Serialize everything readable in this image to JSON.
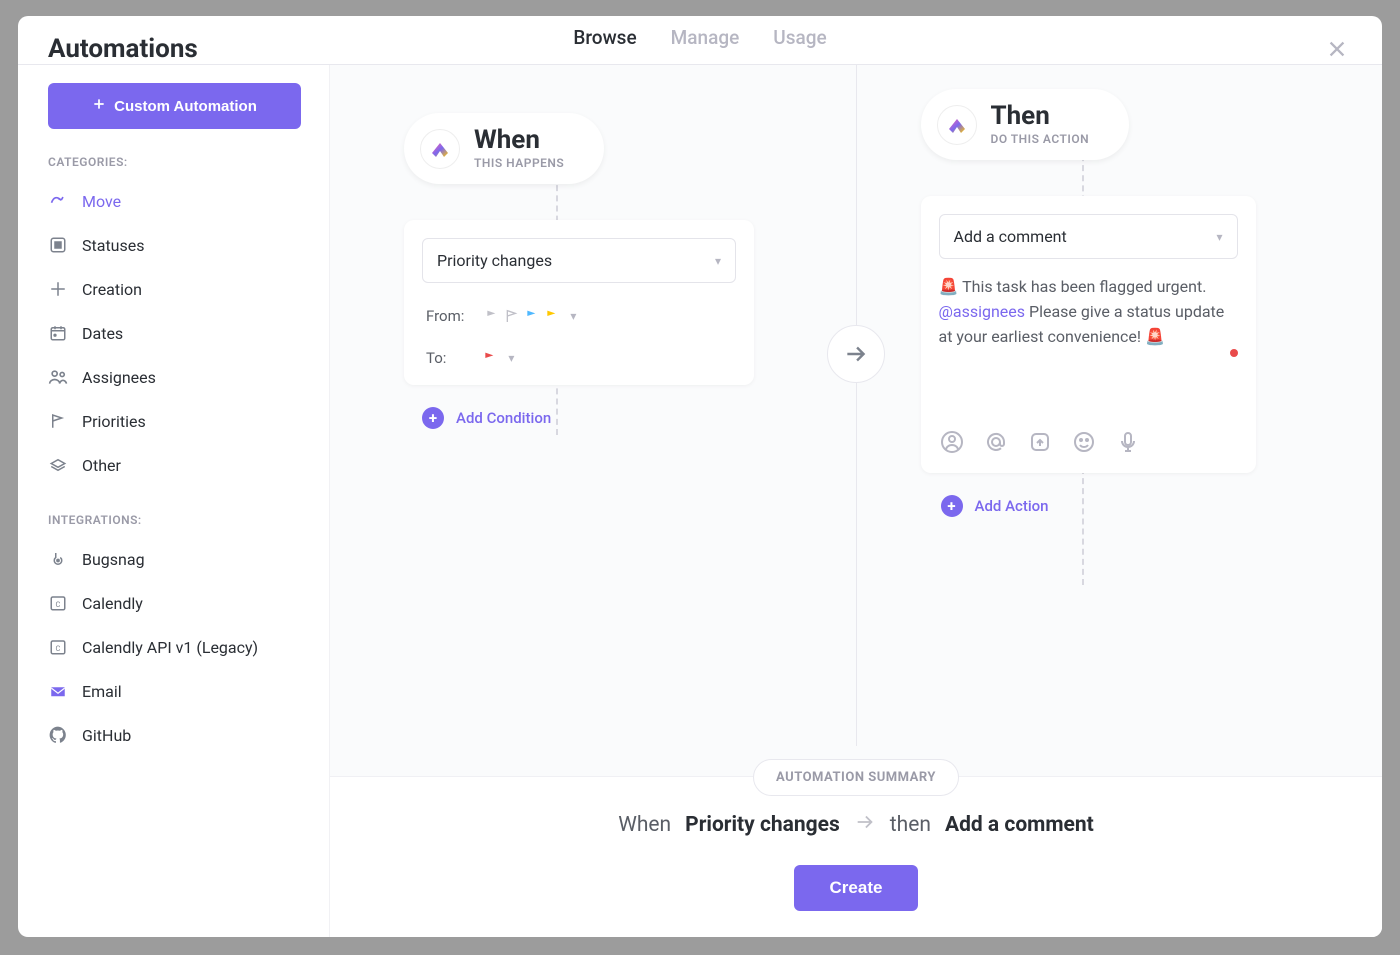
{
  "header": {
    "title": "Automations",
    "tabs": [
      "Browse",
      "Manage",
      "Usage"
    ],
    "activeTab": 0
  },
  "sidebar": {
    "customButton": "Custom Automation",
    "categoriesLabel": "CATEGORIES:",
    "categories": [
      "Move",
      "Statuses",
      "Creation",
      "Dates",
      "Assignees",
      "Priorities",
      "Other"
    ],
    "integrationsLabel": "INTEGRATIONS:",
    "integrations": [
      "Bugsnag",
      "Calendly",
      "Calendly API v1 (Legacy)",
      "Email",
      "GitHub"
    ]
  },
  "when": {
    "title": "When",
    "subtitle": "THIS HAPPENS",
    "trigger": "Priority changes",
    "fromLabel": "From:",
    "toLabel": "To:",
    "addCondition": "Add Condition"
  },
  "then": {
    "title": "Then",
    "subtitle": "DO THIS ACTION",
    "action": "Add a comment",
    "commentPrefix": "🚨 This task has been flagged urgent. ",
    "mention": "@assignees",
    "commentSuffix": " Please give a status update at your earliest convenience! 🚨",
    "addAction": "Add Action"
  },
  "footer": {
    "chip": "AUTOMATION SUMMARY",
    "whenWord": "When",
    "whenBold": "Priority changes",
    "thenWord": "then",
    "thenBold": "Add a comment",
    "create": "Create"
  }
}
